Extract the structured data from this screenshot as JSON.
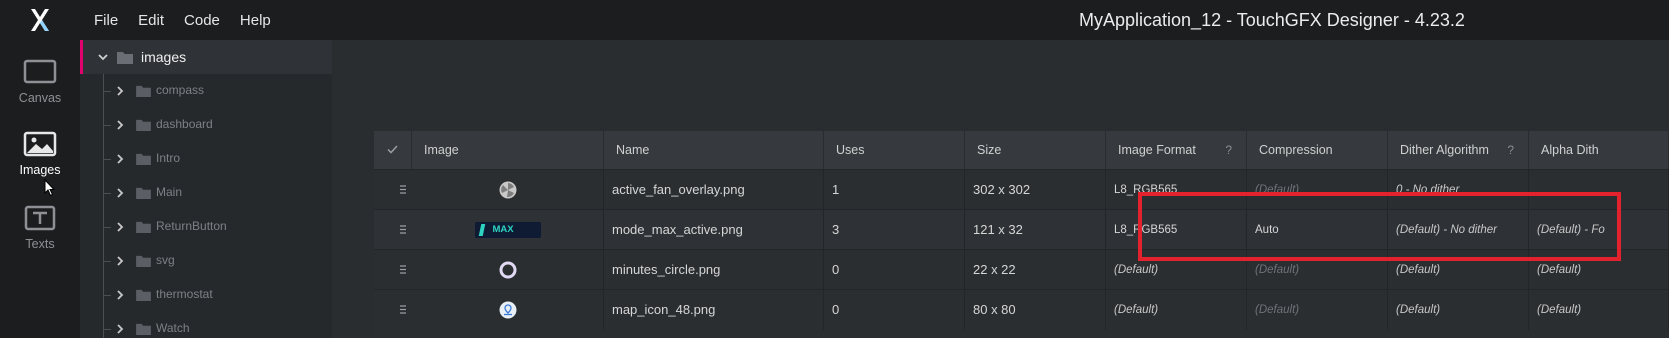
{
  "menu": {
    "items": [
      "File",
      "Edit",
      "Code",
      "Help"
    ]
  },
  "window_title": "MyApplication_12 - TouchGFX Designer - 4.23.2",
  "rail": [
    {
      "label": "Canvas",
      "icon": "canvas-icon"
    },
    {
      "label": "Images",
      "icon": "images-icon",
      "active": true
    },
    {
      "label": "Texts",
      "icon": "texts-icon"
    }
  ],
  "tree": {
    "root": "images",
    "children": [
      "compass",
      "dashboard",
      "Intro",
      "Main",
      "ReturnButton",
      "svg",
      "thermostat",
      "Watch"
    ]
  },
  "table": {
    "headers": [
      "Image",
      "Name",
      "Uses",
      "Size",
      "Image Format",
      "Compression",
      "Dither Algorithm",
      "Alpha Dith"
    ],
    "rows": [
      {
        "thumb": "fan-thumbnail",
        "name": "active_fan_overlay.png",
        "uses": "1",
        "size": "302 x 302",
        "format": "L8_RGB565",
        "compression": "(Default)",
        "dither": "0 - No dither",
        "alpha": ""
      },
      {
        "thumb": "max-thumbnail",
        "thumb_text": "MAX",
        "name": "mode_max_active.png",
        "uses": "3",
        "size": "121 x 32",
        "format": "L8_RGB565",
        "compression": "Auto",
        "dither": "(Default) - No dither",
        "alpha": "(Default) - Fo"
      },
      {
        "thumb": "circle-thumbnail",
        "name": "minutes_circle.png",
        "uses": "0",
        "size": "22 x 22",
        "format": "(Default)",
        "compression": "(Default)",
        "dither": "(Default)",
        "alpha": "(Default)"
      },
      {
        "thumb": "map-icon-thumbnail",
        "name": "map_icon_48.png",
        "uses": "0",
        "size": "80 x 80",
        "format": "(Default)",
        "compression": "(Default)",
        "dither": "(Default)",
        "alpha": "(Default)"
      }
    ]
  },
  "colors": {
    "accent": "#e0006e",
    "highlight": "#e3222d",
    "max_badge": "#2ed3c2"
  }
}
